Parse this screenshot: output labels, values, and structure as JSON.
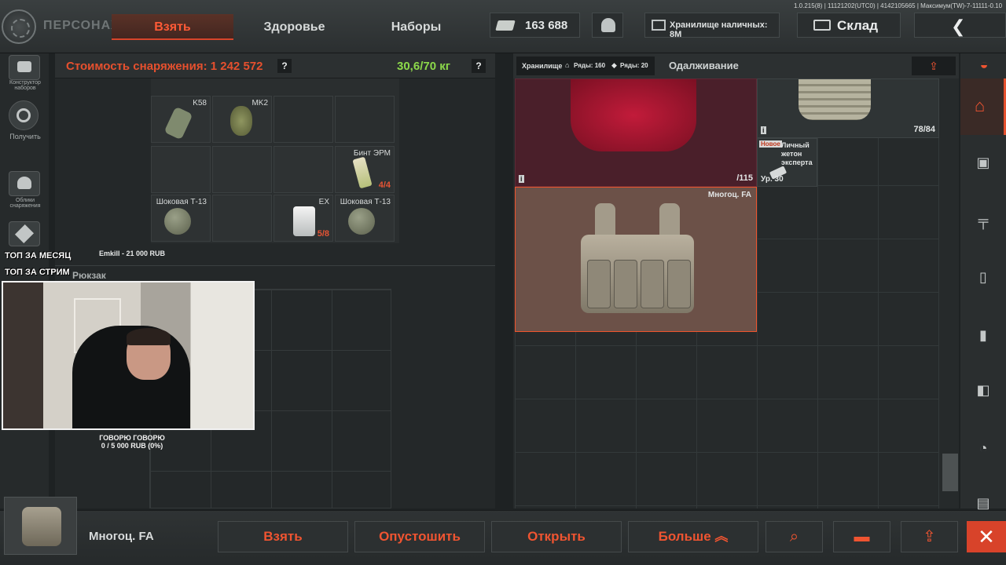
{
  "version": "1.0.215(8) | 11121202(UTC0) | 4142105665 | Максимум(TW)-7-11111-0.10",
  "header": {
    "title": "ПЕРСОНАЖ",
    "tabs": [
      "Взять",
      "Здоровье",
      "Наборы"
    ],
    "money": "163 688",
    "cash_storage": "Хранилище наличных: 8M",
    "stash": "Склад"
  },
  "left_sidebar": {
    "items": [
      {
        "label": "Конструктор наборов",
        "icon": "toolbox-icon"
      },
      {
        "label": "Получить",
        "icon": "receive-icon"
      },
      {
        "label": "Облики снаряжения",
        "icon": "helmet-icon"
      },
      {
        "label": "",
        "icon": "tools-icon"
      }
    ]
  },
  "loadout": {
    "cost": "Стоимость снаряжения: 1 242 572",
    "help": "?",
    "weight": "30,6/70 кг",
    "slots": [
      {
        "name": "K58",
        "count": ""
      },
      {
        "name": "MK2",
        "count": ""
      },
      {
        "name": "Бинт ЭРМ",
        "count": "4/4"
      },
      {
        "name": "Шоковая Т-13",
        "count": ""
      },
      {
        "name": "EX",
        "count": "5/8"
      },
      {
        "name": "Шоковая Т-13",
        "count": ""
      }
    ],
    "backpack_label": "Рюкзак"
  },
  "stream": {
    "donor": "Emkill - 21 000 RUB",
    "top_month": "ТОП ЗА МЕСЯЦ",
    "top_stream": "ТОП ЗА СТРИМ",
    "goal_title": "ГОВОРЮ ГОВОРЮ",
    "goal_progress": "0 / 5 000 RUB (0%)"
  },
  "storage": {
    "tab_label": "Хранилище",
    "rows1": "Ряды: 160",
    "rows2": "Ряды: 20",
    "lend_tab": "Одалживание",
    "crimson_durability": "/115",
    "plate_durability": "78/84",
    "tag_new": "Новое",
    "tag_name": "Личный жетон эксперта",
    "tag_level": "Ур. 30",
    "selected_name": "Многоц. FA"
  },
  "bottom": {
    "selected_name": "Многоц. FA",
    "buttons": [
      "Взять",
      "Опустошить",
      "Открыть",
      "Больше"
    ]
  },
  "colors": {
    "accent": "#ef5431",
    "weight": "#8cd94a",
    "selected_border": "#f0542c"
  }
}
